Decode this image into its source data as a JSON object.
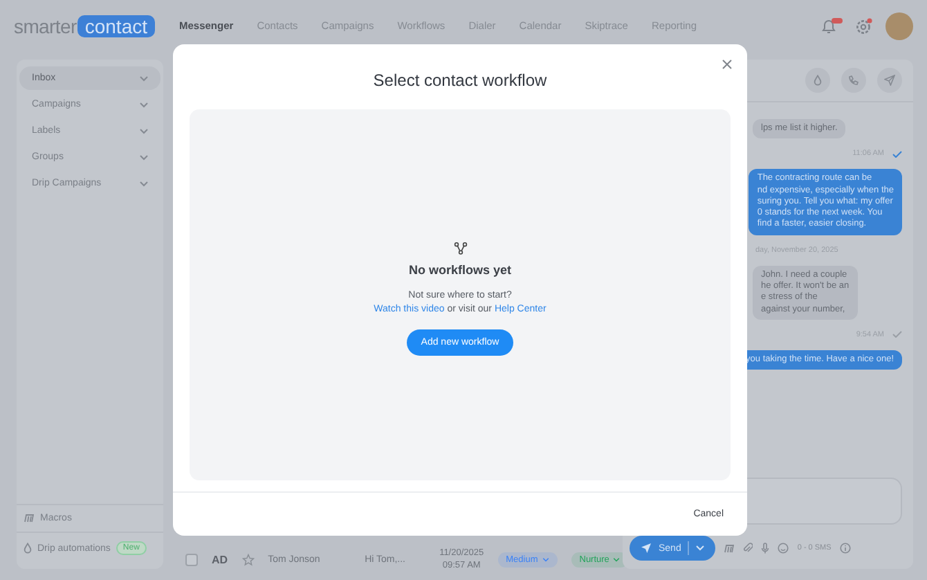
{
  "header": {
    "logo": {
      "part_1": "smarter",
      "part_2": "contact"
    },
    "nav": [
      {
        "label": "Messenger",
        "selected": true
      },
      {
        "label": "Contacts",
        "selected": false
      },
      {
        "label": "Campaigns",
        "selected": false
      },
      {
        "label": "Workflows",
        "selected": false
      },
      {
        "label": "Dialer",
        "selected": false
      },
      {
        "label": "Calendar",
        "selected": false
      },
      {
        "label": "Skiptrace",
        "selected": false
      },
      {
        "label": "Reporting",
        "selected": false
      }
    ]
  },
  "sidebar": {
    "items": [
      {
        "label": "Inbox",
        "selected": true
      },
      {
        "label": "Campaigns",
        "selected": false
      },
      {
        "label": "Labels",
        "selected": false
      },
      {
        "label": "Groups",
        "selected": false
      },
      {
        "label": "Drip Campaigns",
        "selected": false
      }
    ],
    "footer": [
      {
        "kind": "macros",
        "label": "Macros"
      },
      {
        "kind": "drip",
        "label": "Drip automations",
        "badge": "New"
      }
    ]
  },
  "contact_row": {
    "checked": false,
    "initials": "AD",
    "starred": false,
    "name": "Tom Jonson",
    "preview": "Hi Tom,...",
    "date": "11/20/2025",
    "time": "09:57 AM",
    "tags": [
      {
        "label": "Medium",
        "color": "#3b82f6"
      },
      {
        "label": "Nurture",
        "color": "#22a35a"
      }
    ]
  },
  "chat": {
    "messages": [
      {
        "kind": "incoming",
        "lines": [
          "lps me list it higher."
        ]
      },
      {
        "kind": "timestamp",
        "text": "11:06 AM",
        "read": true
      },
      {
        "kind": "outgoing",
        "lines": [
          "The contracting route can be",
          "nd expensive, especially when the",
          "suring you. Tell you what: my offer",
          "0 stands for the next week. You",
          "find a faster, easier closing."
        ]
      },
      {
        "kind": "divider",
        "text": "day, November 20, 2025"
      },
      {
        "kind": "incoming",
        "lines": [
          "John. I need a couple",
          "he offer. It won't be an",
          "e stress of the",
          "against your number,"
        ]
      },
      {
        "kind": "timestamp",
        "text": "9:54 AM",
        "read": false
      },
      {
        "kind": "outgoing",
        "lines": [
          "you taking the time. Have a nice one!"
        ]
      }
    ],
    "send": "Send",
    "sms_count": "0 - 0 SMS"
  },
  "modal": {
    "title": "Select contact workflow",
    "empty_title": "No workflows yet",
    "prompt": "Not sure where to start?",
    "link_1": "Watch this video",
    "joiner": "or visit our",
    "link_2": "Help Center",
    "add_button": "Add new workflow",
    "cancel": "Cancel"
  }
}
